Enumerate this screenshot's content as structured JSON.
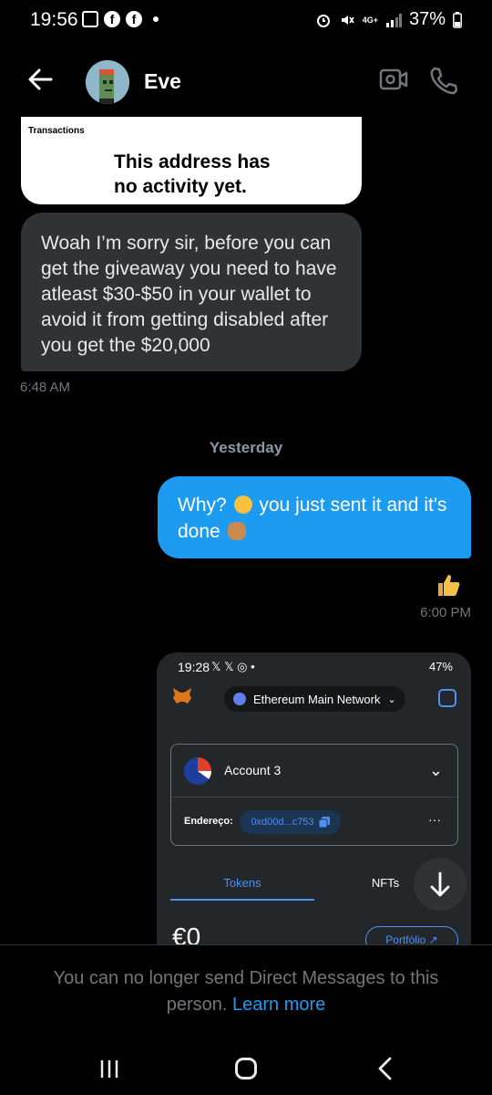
{
  "status_bar": {
    "time": "19:56",
    "battery": "37%",
    "network": "4G+"
  },
  "header": {
    "contact_name": "Eve"
  },
  "card": {
    "label": "Transactions",
    "message_line1": "This address has",
    "message_line2": "no activity yet."
  },
  "messages": {
    "incoming_text": "Woah I’m sorry sir, before you can get the giveaway you need to have atleast $30-$50 in your wallet to avoid it from getting disabled after you get the $20,000",
    "incoming_time": "6:48 AM",
    "day_separator": "Yesterday",
    "outgoing_part1": "Why?",
    "outgoing_part2": "you just sent it and it's done",
    "outgoing_time": "6:00 PM"
  },
  "screenshot": {
    "time": "19:28",
    "battery": "47%",
    "network_name": "Ethereum Main Network",
    "account_name": "Account 3",
    "address_label": "Endereço:",
    "address_value": "0xd00d...c753",
    "tab_tokens": "Tokens",
    "tab_nfts": "NFTs",
    "balance": "€0",
    "portfolio_button": "Portfólio"
  },
  "footer": {
    "notice": "You can no longer send Direct Messages to this person.",
    "learn_more": "Learn more"
  },
  "colors": {
    "accent": "#1d9bf0",
    "incoming_bubble": "#2f3336",
    "metamask_blue": "#4c8ff5"
  }
}
